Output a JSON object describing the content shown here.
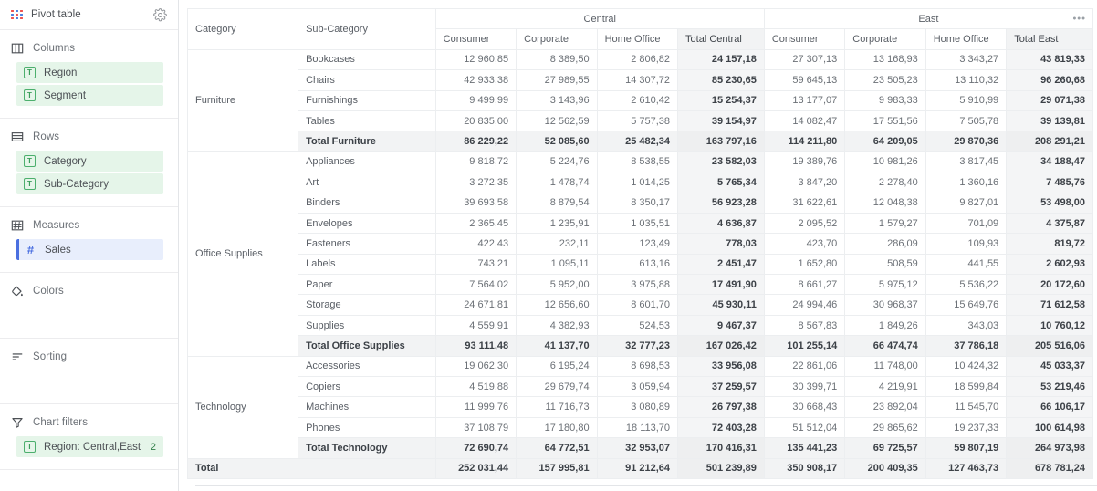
{
  "sidebar": {
    "header": {
      "title": "Pivot table",
      "gear_icon": "gear-icon",
      "pivot_icon": "pivot-table-icon"
    },
    "sections": [
      {
        "key": "columns",
        "label": "Columns",
        "icon": "columns-icon",
        "fields": [
          {
            "label": "Region",
            "icon": "text-field-icon"
          },
          {
            "label": "Segment",
            "icon": "text-field-icon"
          }
        ]
      },
      {
        "key": "rows",
        "label": "Rows",
        "icon": "rows-icon",
        "fields": [
          {
            "label": "Category",
            "icon": "text-field-icon"
          },
          {
            "label": "Sub-Category",
            "icon": "text-field-icon"
          }
        ]
      },
      {
        "key": "measures",
        "label": "Measures",
        "icon": "measures-icon",
        "fields": [
          {
            "label": "Sales",
            "icon": "number-field-icon"
          }
        ]
      },
      {
        "key": "colors",
        "label": "Colors",
        "icon": "color-bucket-icon",
        "fields": []
      },
      {
        "key": "sorting",
        "label": "Sorting",
        "icon": "sorting-icon",
        "fields": []
      },
      {
        "key": "chart_filters",
        "label": "Chart filters",
        "icon": "filter-icon",
        "fields": [
          {
            "label": "Region: Central,East",
            "icon": "text-field-icon",
            "count": "2"
          }
        ]
      }
    ]
  },
  "table": {
    "row_headers": [
      "Category",
      "Sub-Category"
    ],
    "groups": [
      {
        "name": "Central",
        "columns": [
          "Consumer",
          "Corporate",
          "Home Office",
          "Total Central"
        ],
        "total_index": 3
      },
      {
        "name": "East",
        "columns": [
          "Consumer",
          "Corporate",
          "Home Office",
          "Total East"
        ],
        "total_index": 3,
        "menu_icon": "more-options-icon"
      }
    ],
    "sections": [
      {
        "category": "Furniture",
        "rows": [
          {
            "sub": "Bookcases",
            "values": [
              "12 960,85",
              "8 389,50",
              "2 806,82",
              "24 157,18",
              "27 307,13",
              "13 168,93",
              "3 343,27",
              "43 819,33"
            ]
          },
          {
            "sub": "Chairs",
            "values": [
              "42 933,38",
              "27 989,55",
              "14 307,72",
              "85 230,65",
              "59 645,13",
              "23 505,23",
              "13 110,32",
              "96 260,68"
            ]
          },
          {
            "sub": "Furnishings",
            "values": [
              "9 499,99",
              "3 143,96",
              "2 610,42",
              "15 254,37",
              "13 177,07",
              "9 983,33",
              "5 910,99",
              "29 071,38"
            ]
          },
          {
            "sub": "Tables",
            "values": [
              "20 835,00",
              "12 562,59",
              "5 757,38",
              "39 154,97",
              "14 082,47",
              "17 551,56",
              "7 505,78",
              "39 139,81"
            ]
          }
        ],
        "total": {
          "sub": "Total Furniture",
          "values": [
            "86 229,22",
            "52 085,60",
            "25 482,34",
            "163 797,16",
            "114 211,80",
            "64 209,05",
            "29 870,36",
            "208 291,21"
          ]
        }
      },
      {
        "category": "Office Supplies",
        "rows": [
          {
            "sub": "Appliances",
            "values": [
              "9 818,72",
              "5 224,76",
              "8 538,55",
              "23 582,03",
              "19 389,76",
              "10 981,26",
              "3 817,45",
              "34 188,47"
            ]
          },
          {
            "sub": "Art",
            "values": [
              "3 272,35",
              "1 478,74",
              "1 014,25",
              "5 765,34",
              "3 847,20",
              "2 278,40",
              "1 360,16",
              "7 485,76"
            ]
          },
          {
            "sub": "Binders",
            "values": [
              "39 693,58",
              "8 879,54",
              "8 350,17",
              "56 923,28",
              "31 622,61",
              "12 048,38",
              "9 827,01",
              "53 498,00"
            ]
          },
          {
            "sub": "Envelopes",
            "values": [
              "2 365,45",
              "1 235,91",
              "1 035,51",
              "4 636,87",
              "2 095,52",
              "1 579,27",
              "701,09",
              "4 375,87"
            ]
          },
          {
            "sub": "Fasteners",
            "values": [
              "422,43",
              "232,11",
              "123,49",
              "778,03",
              "423,70",
              "286,09",
              "109,93",
              "819,72"
            ]
          },
          {
            "sub": "Labels",
            "values": [
              "743,21",
              "1 095,11",
              "613,16",
              "2 451,47",
              "1 652,80",
              "508,59",
              "441,55",
              "2 602,93"
            ]
          },
          {
            "sub": "Paper",
            "values": [
              "7 564,02",
              "5 952,00",
              "3 975,88",
              "17 491,90",
              "8 661,27",
              "5 975,12",
              "5 536,22",
              "20 172,60"
            ]
          },
          {
            "sub": "Storage",
            "values": [
              "24 671,81",
              "12 656,60",
              "8 601,70",
              "45 930,11",
              "24 994,46",
              "30 968,37",
              "15 649,76",
              "71 612,58"
            ]
          },
          {
            "sub": "Supplies",
            "values": [
              "4 559,91",
              "4 382,93",
              "524,53",
              "9 467,37",
              "8 567,83",
              "1 849,26",
              "343,03",
              "10 760,12"
            ]
          }
        ],
        "total": {
          "sub": "Total Office Supplies",
          "values": [
            "93 111,48",
            "41 137,70",
            "32 777,23",
            "167 026,42",
            "101 255,14",
            "66 474,74",
            "37 786,18",
            "205 516,06"
          ]
        }
      },
      {
        "category": "Technology",
        "rows": [
          {
            "sub": "Accessories",
            "values": [
              "19 062,30",
              "6 195,24",
              "8 698,53",
              "33 956,08",
              "22 861,06",
              "11 748,00",
              "10 424,32",
              "45 033,37"
            ]
          },
          {
            "sub": "Copiers",
            "values": [
              "4 519,88",
              "29 679,74",
              "3 059,94",
              "37 259,57",
              "30 399,71",
              "4 219,91",
              "18 599,84",
              "53 219,46"
            ]
          },
          {
            "sub": "Machines",
            "values": [
              "11 999,76",
              "11 716,73",
              "3 080,89",
              "26 797,38",
              "30 668,43",
              "23 892,04",
              "11 545,70",
              "66 106,17"
            ]
          },
          {
            "sub": "Phones",
            "values": [
              "37 108,79",
              "17 180,80",
              "18 113,70",
              "72 403,28",
              "51 512,04",
              "29 865,62",
              "19 237,33",
              "100 614,98"
            ]
          }
        ],
        "total": {
          "sub": "Total Technology",
          "values": [
            "72 690,74",
            "64 772,51",
            "32 953,07",
            "170 416,31",
            "135 441,23",
            "69 725,57",
            "59 807,19",
            "264 973,98"
          ]
        }
      }
    ],
    "grand_total": {
      "label": "Total",
      "sub": "",
      "values": [
        "252 031,44",
        "157 995,81",
        "91 212,64",
        "501 239,89",
        "350 908,17",
        "200 409,35",
        "127 463,73",
        "678 781,24"
      ]
    }
  },
  "colors": {
    "field_green_bg": "#e5f5e9",
    "measure_blue_bg": "#e8eefc",
    "measure_accent": "#4a6fe0",
    "total_bg": "#f2f3f4"
  }
}
